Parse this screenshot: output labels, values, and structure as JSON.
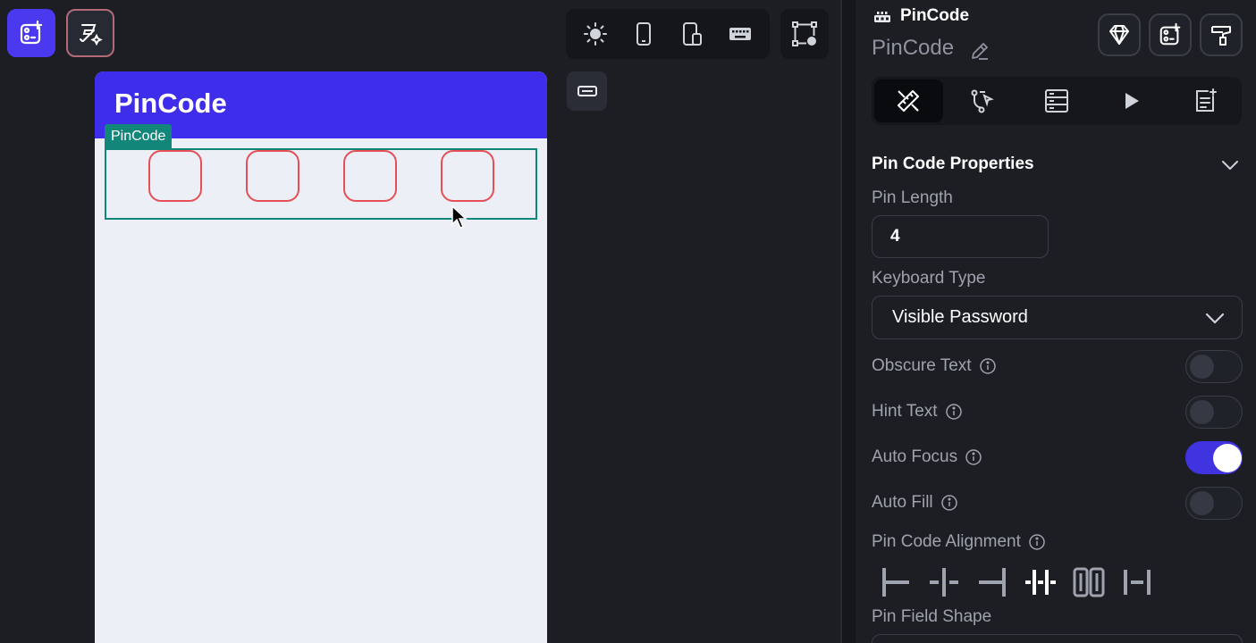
{
  "toolbar": {
    "icons": [
      "add-widget-icon",
      "magic-design-icon",
      "light-mode-icon",
      "phone-icon",
      "tablet-icon",
      "keyboard-icon",
      "graph-settings-icon",
      "widget-outline-icon"
    ]
  },
  "canvas": {
    "app_bar_title": "PinCode",
    "selection_label": "PinCode",
    "pin_count": 4,
    "colors": {
      "app_bar": "#3f2dec",
      "pin_border": "#e64f55",
      "selection": "#13867a"
    }
  },
  "panel": {
    "widget_type": "PinCode",
    "widget_name": "PinCode",
    "tabs": [
      "properties-icon",
      "actions-icon",
      "backend-query-icon",
      "animations-icon",
      "notes-icon"
    ],
    "section_title": "Pin Code Properties",
    "pin_length_label": "Pin Length",
    "pin_length_value": "4",
    "keyboard_type_label": "Keyboard Type",
    "keyboard_type_value": "Visible Password",
    "toggles": {
      "obscure_text": {
        "label": "Obscure Text",
        "on": false
      },
      "hint_text": {
        "label": "Hint Text",
        "on": false
      },
      "auto_focus": {
        "label": "Auto Focus",
        "on": true
      },
      "auto_fill": {
        "label": "Auto Fill",
        "on": false
      }
    },
    "alignment_label": "Pin Code Alignment",
    "alignment_selected": "center",
    "pin_field_shape_label": "Pin Field Shape",
    "accent": "#3f34e0"
  }
}
